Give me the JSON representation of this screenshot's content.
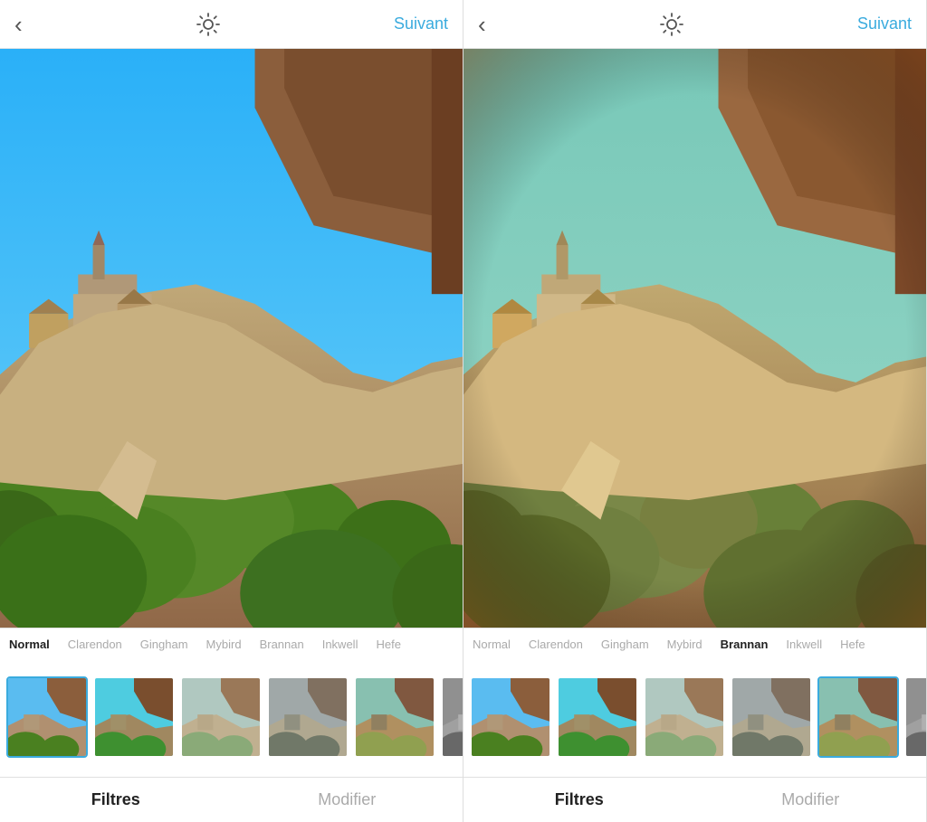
{
  "panels": [
    {
      "id": "left",
      "header": {
        "back_label": "‹",
        "next_label": "Suivant",
        "back_aria": "back"
      },
      "filters": {
        "items": [
          {
            "id": "normal",
            "label": "Normal",
            "active": true,
            "selected": false
          },
          {
            "id": "clarendon",
            "label": "Clarendon",
            "active": false,
            "selected": false
          },
          {
            "id": "gingham",
            "label": "Gingham",
            "active": false,
            "selected": false
          },
          {
            "id": "mybird",
            "label": "Mybird",
            "active": false,
            "selected": false
          },
          {
            "id": "brannan",
            "label": "Brannan",
            "active": false,
            "selected": false
          },
          {
            "id": "inkwell",
            "label": "Inkwell",
            "active": false,
            "selected": false
          },
          {
            "id": "hefe",
            "label": "Hefe",
            "active": false,
            "selected": false
          }
        ]
      },
      "bottom_nav": {
        "primary": "Filtres",
        "secondary": "Modifier"
      }
    },
    {
      "id": "right",
      "header": {
        "back_label": "‹",
        "next_label": "Suivant",
        "back_aria": "back"
      },
      "filters": {
        "items": [
          {
            "id": "normal",
            "label": "Normal",
            "active": false,
            "selected": false
          },
          {
            "id": "clarendon",
            "label": "Clarendon",
            "active": false,
            "selected": false
          },
          {
            "id": "gingham",
            "label": "Gingham",
            "active": false,
            "selected": false
          },
          {
            "id": "mybird",
            "label": "Mybird",
            "active": false,
            "selected": false
          },
          {
            "id": "brannan",
            "label": "Brannan",
            "active": false,
            "selected": true
          },
          {
            "id": "inkwell",
            "label": "Inkwell",
            "active": false,
            "selected": false
          },
          {
            "id": "hefe",
            "label": "Hefe",
            "active": false,
            "selected": false
          }
        ]
      },
      "bottom_nav": {
        "primary": "Filtres",
        "secondary": "Modifier"
      }
    }
  ],
  "accent_color": "#3aabde",
  "filter_colors": {
    "normal": {
      "sky": "#4db8f0",
      "land": "#6a8f3a",
      "rock": "#a09070"
    },
    "clarendon": {
      "sky": "#5bc8f5",
      "land": "#4fa840",
      "rock": "#8a7860"
    },
    "gingham": {
      "sky": "#c0d8d0",
      "land": "#90a880",
      "rock": "#b8a898"
    },
    "mybird": {
      "sky": "#b0b8b8",
      "land": "#7a8870",
      "rock": "#989088"
    },
    "brannan": {
      "sky": "#88c0b0",
      "land": "#a09050",
      "rock": "#907860"
    },
    "inkwell": {
      "sky": "#888888",
      "land": "#707070",
      "rock": "#909090"
    },
    "hefe": {
      "sky": "#90a860",
      "land": "#887040",
      "rock": "#806850"
    }
  }
}
